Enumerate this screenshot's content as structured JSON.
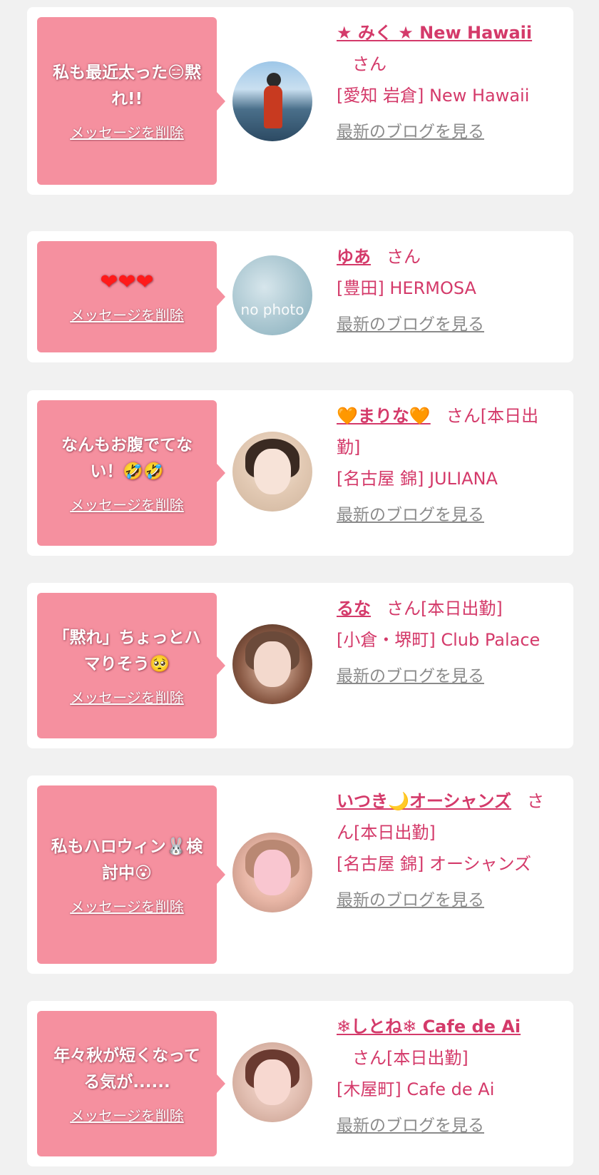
{
  "messages": [
    {
      "text": "私も最近太った😑黙れ!!",
      "delete_label": "メッセージを削除",
      "name": "★ みく ★ New Hawaii",
      "honorific": "さん",
      "status": "",
      "shop": "[愛知 岩倉] New Hawaii",
      "blog_label": "最新のブログを見る"
    },
    {
      "text": "❤❤❤",
      "delete_label": "メッセージを削除",
      "name": "ゆあ",
      "honorific": "さん",
      "status": "",
      "shop": "[豊田] HERMOSA",
      "blog_label": "最新のブログを見る",
      "avatar_text": "no photo"
    },
    {
      "text": "なんもお腹でてない！🤣🤣",
      "delete_label": "メッセージを削除",
      "name": "🧡まりな🧡",
      "honorific": "さん",
      "status": "[本日出勤]",
      "shop": "[名古屋 錦] JULIANA",
      "blog_label": "最新のブログを見る"
    },
    {
      "text": "「黙れ」ちょっとハマりそう🥺",
      "delete_label": "メッセージを削除",
      "name": "るな",
      "honorific": "さん",
      "status": "[本日出勤]",
      "shop": "[小倉・堺町] Club Palace",
      "blog_label": "最新のブログを見る"
    },
    {
      "text": "私もハロウィン🐰検討中😮",
      "delete_label": "メッセージを削除",
      "name": "いつき🌙オーシャンズ",
      "honorific": "さん",
      "status": "[本日出勤]",
      "shop": "[名古屋 錦] オーシャンズ",
      "blog_label": "最新のブログを見る"
    },
    {
      "text": "年々秋が短くなってる気が......",
      "delete_label": "メッセージを削除",
      "name": "❄しとね❄ Cafe de Ai",
      "honorific": "さん",
      "status": "[本日出勤]",
      "shop": "[木屋町] Cafe de Ai",
      "blog_label": "最新のブログを見る"
    }
  ],
  "colors": {
    "page_background": "#f1f1f1",
    "card_background": "#ffffff",
    "bubble_pink": "#f5909f",
    "accent_text": "#d43a6a",
    "link_gray": "#8b8b8b"
  }
}
